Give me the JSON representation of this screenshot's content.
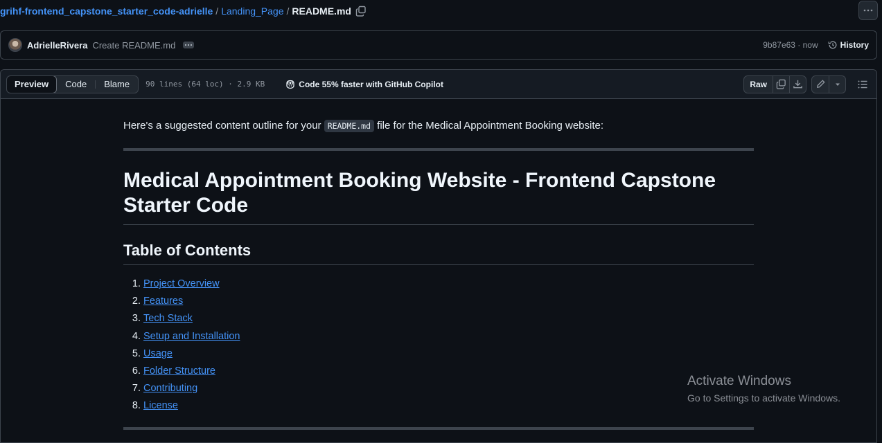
{
  "breadcrumb": {
    "repo": "grihf-frontend_capstone_starter_code-adrielle",
    "folder": "Landing_Page",
    "file": "README.md",
    "separator": "/"
  },
  "commit": {
    "author": "AdrielleRivera",
    "message": "Create README.md",
    "sha_time": "9b87e63 · now",
    "history_label": "History"
  },
  "file_header": {
    "tabs": [
      "Preview",
      "Code",
      "Blame"
    ],
    "active_tab": "Preview",
    "meta": "90 lines (64 loc) · 2.9 KB",
    "copilot": "Code 55% faster with GitHub Copilot",
    "raw_label": "Raw"
  },
  "markdown": {
    "intro_before": "Here's a suggested content outline for your ",
    "intro_code": "README.md",
    "intro_after": " file for the Medical Appointment Booking website:",
    "title": "Medical Appointment Booking Website - Frontend Capstone Starter Code",
    "toc_heading": "Table of Contents",
    "toc": [
      "Project Overview",
      "Features",
      "Tech Stack",
      "Setup and Installation",
      "Usage",
      "Folder Structure",
      "Contributing",
      "License"
    ]
  },
  "watermark": {
    "title": "Activate Windows",
    "subtitle": "Go to Settings to activate Windows."
  },
  "colors": {
    "background": "#0d1117",
    "link": "#4493f8",
    "border": "#3d444d",
    "muted": "#9198a1"
  }
}
